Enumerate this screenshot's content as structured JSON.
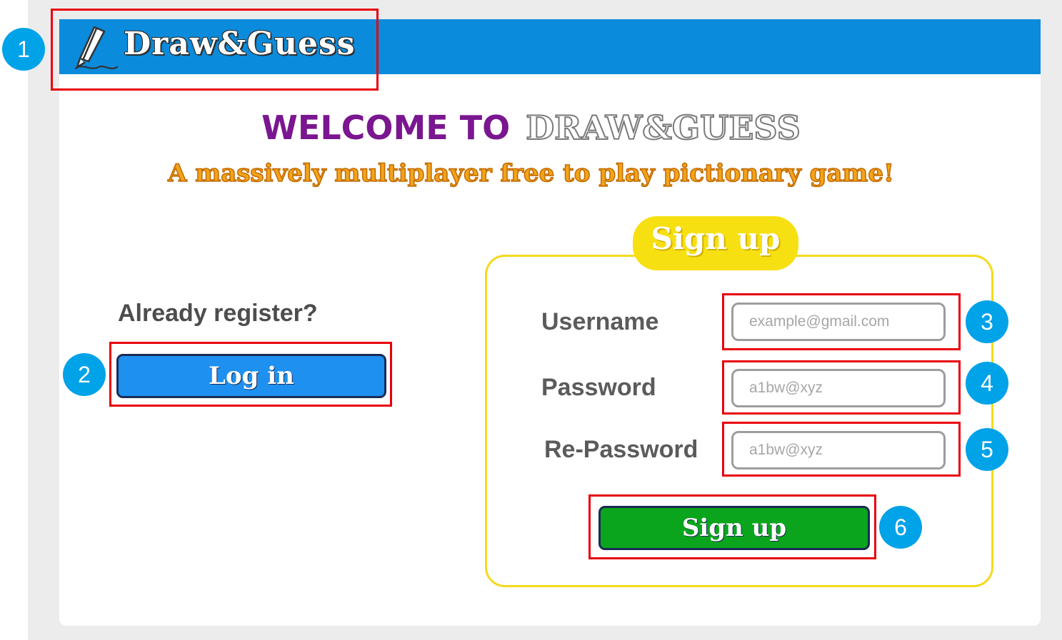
{
  "header": {
    "logo_text": "Draw&Guess"
  },
  "welcome": {
    "line1": "WELCOME TO",
    "line2": "DRAW&GUESS",
    "tagline": "A massively multiplayer free to play pictionary game!"
  },
  "login": {
    "prompt": "Already register?",
    "button_label": "Log in"
  },
  "signup": {
    "title": "Sign up",
    "fields": [
      {
        "label": "Username",
        "placeholder": "example@gmail.com"
      },
      {
        "label": "Password",
        "placeholder": "a1bw@xyz"
      },
      {
        "label": "Re-Password",
        "placeholder": "a1bw@xyz"
      }
    ],
    "button_label": "Sign up"
  },
  "annotations": [
    "1",
    "2",
    "3",
    "4",
    "5",
    "6"
  ],
  "colors": {
    "header": "#0b8bdc",
    "welcome_purple": "#7a1690",
    "tagline_orange": "#f2a41a",
    "login_blue": "#1e90f0",
    "signup_green": "#0aa51c",
    "signup_yellow": "#f5d91c",
    "highlight_red": "#e8000b",
    "badge_blue": "#00a2e8"
  }
}
